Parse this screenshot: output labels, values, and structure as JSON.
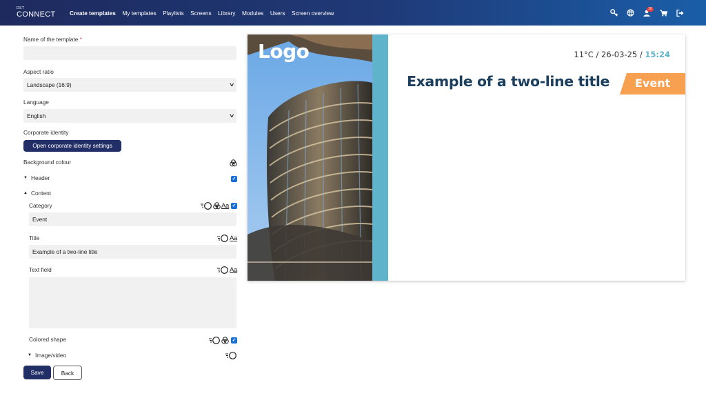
{
  "brand": {
    "top": "DST",
    "bottom": "CONNECT"
  },
  "nav": [
    {
      "label": "Create templates",
      "active": true
    },
    {
      "label": "My templates"
    },
    {
      "label": "Playlists"
    },
    {
      "label": "Screens"
    },
    {
      "label": "Library"
    },
    {
      "label": "Modules"
    },
    {
      "label": "Users"
    },
    {
      "label": "Screen overview"
    }
  ],
  "top_icons": [
    "key-icon",
    "globe-icon",
    "user-icon",
    "cart-icon",
    "logout-icon"
  ],
  "notifications_count": "10",
  "form": {
    "name_label": "Name of the template",
    "name_required": "*",
    "name_value": "",
    "aspect_label": "Aspect ratio",
    "aspect_value": "Landscape (16:9)",
    "language_label": "Language",
    "language_value": "English",
    "corporate_label": "Corporate identity",
    "corporate_button": "Open corporate identity settings",
    "background_label": "Background colour",
    "header_label": "Header",
    "content_label": "Content",
    "category_label": "Category",
    "category_value": "Event",
    "title_label": "Title",
    "title_value": "Example of a two-line title",
    "textfield_label": "Text field",
    "textfield_value": "",
    "colored_shape_label": "Colored shape",
    "image_video_label": "Image/video",
    "font_glyph": "Aa",
    "save_label": "Save",
    "back_label": "Back"
  },
  "preview": {
    "logo": "Logo",
    "temperature": "11°C",
    "separator": "/",
    "date": "26-03-25",
    "time": "15:24",
    "title": "Example of a two-line title",
    "category": "Event"
  },
  "colors": {
    "nav_dark": "#1e2a5e",
    "button": "#222f66",
    "accent_stripe": "#5fb3ca",
    "event_orange": "#f7a050",
    "title_text": "#1d3f5e"
  }
}
